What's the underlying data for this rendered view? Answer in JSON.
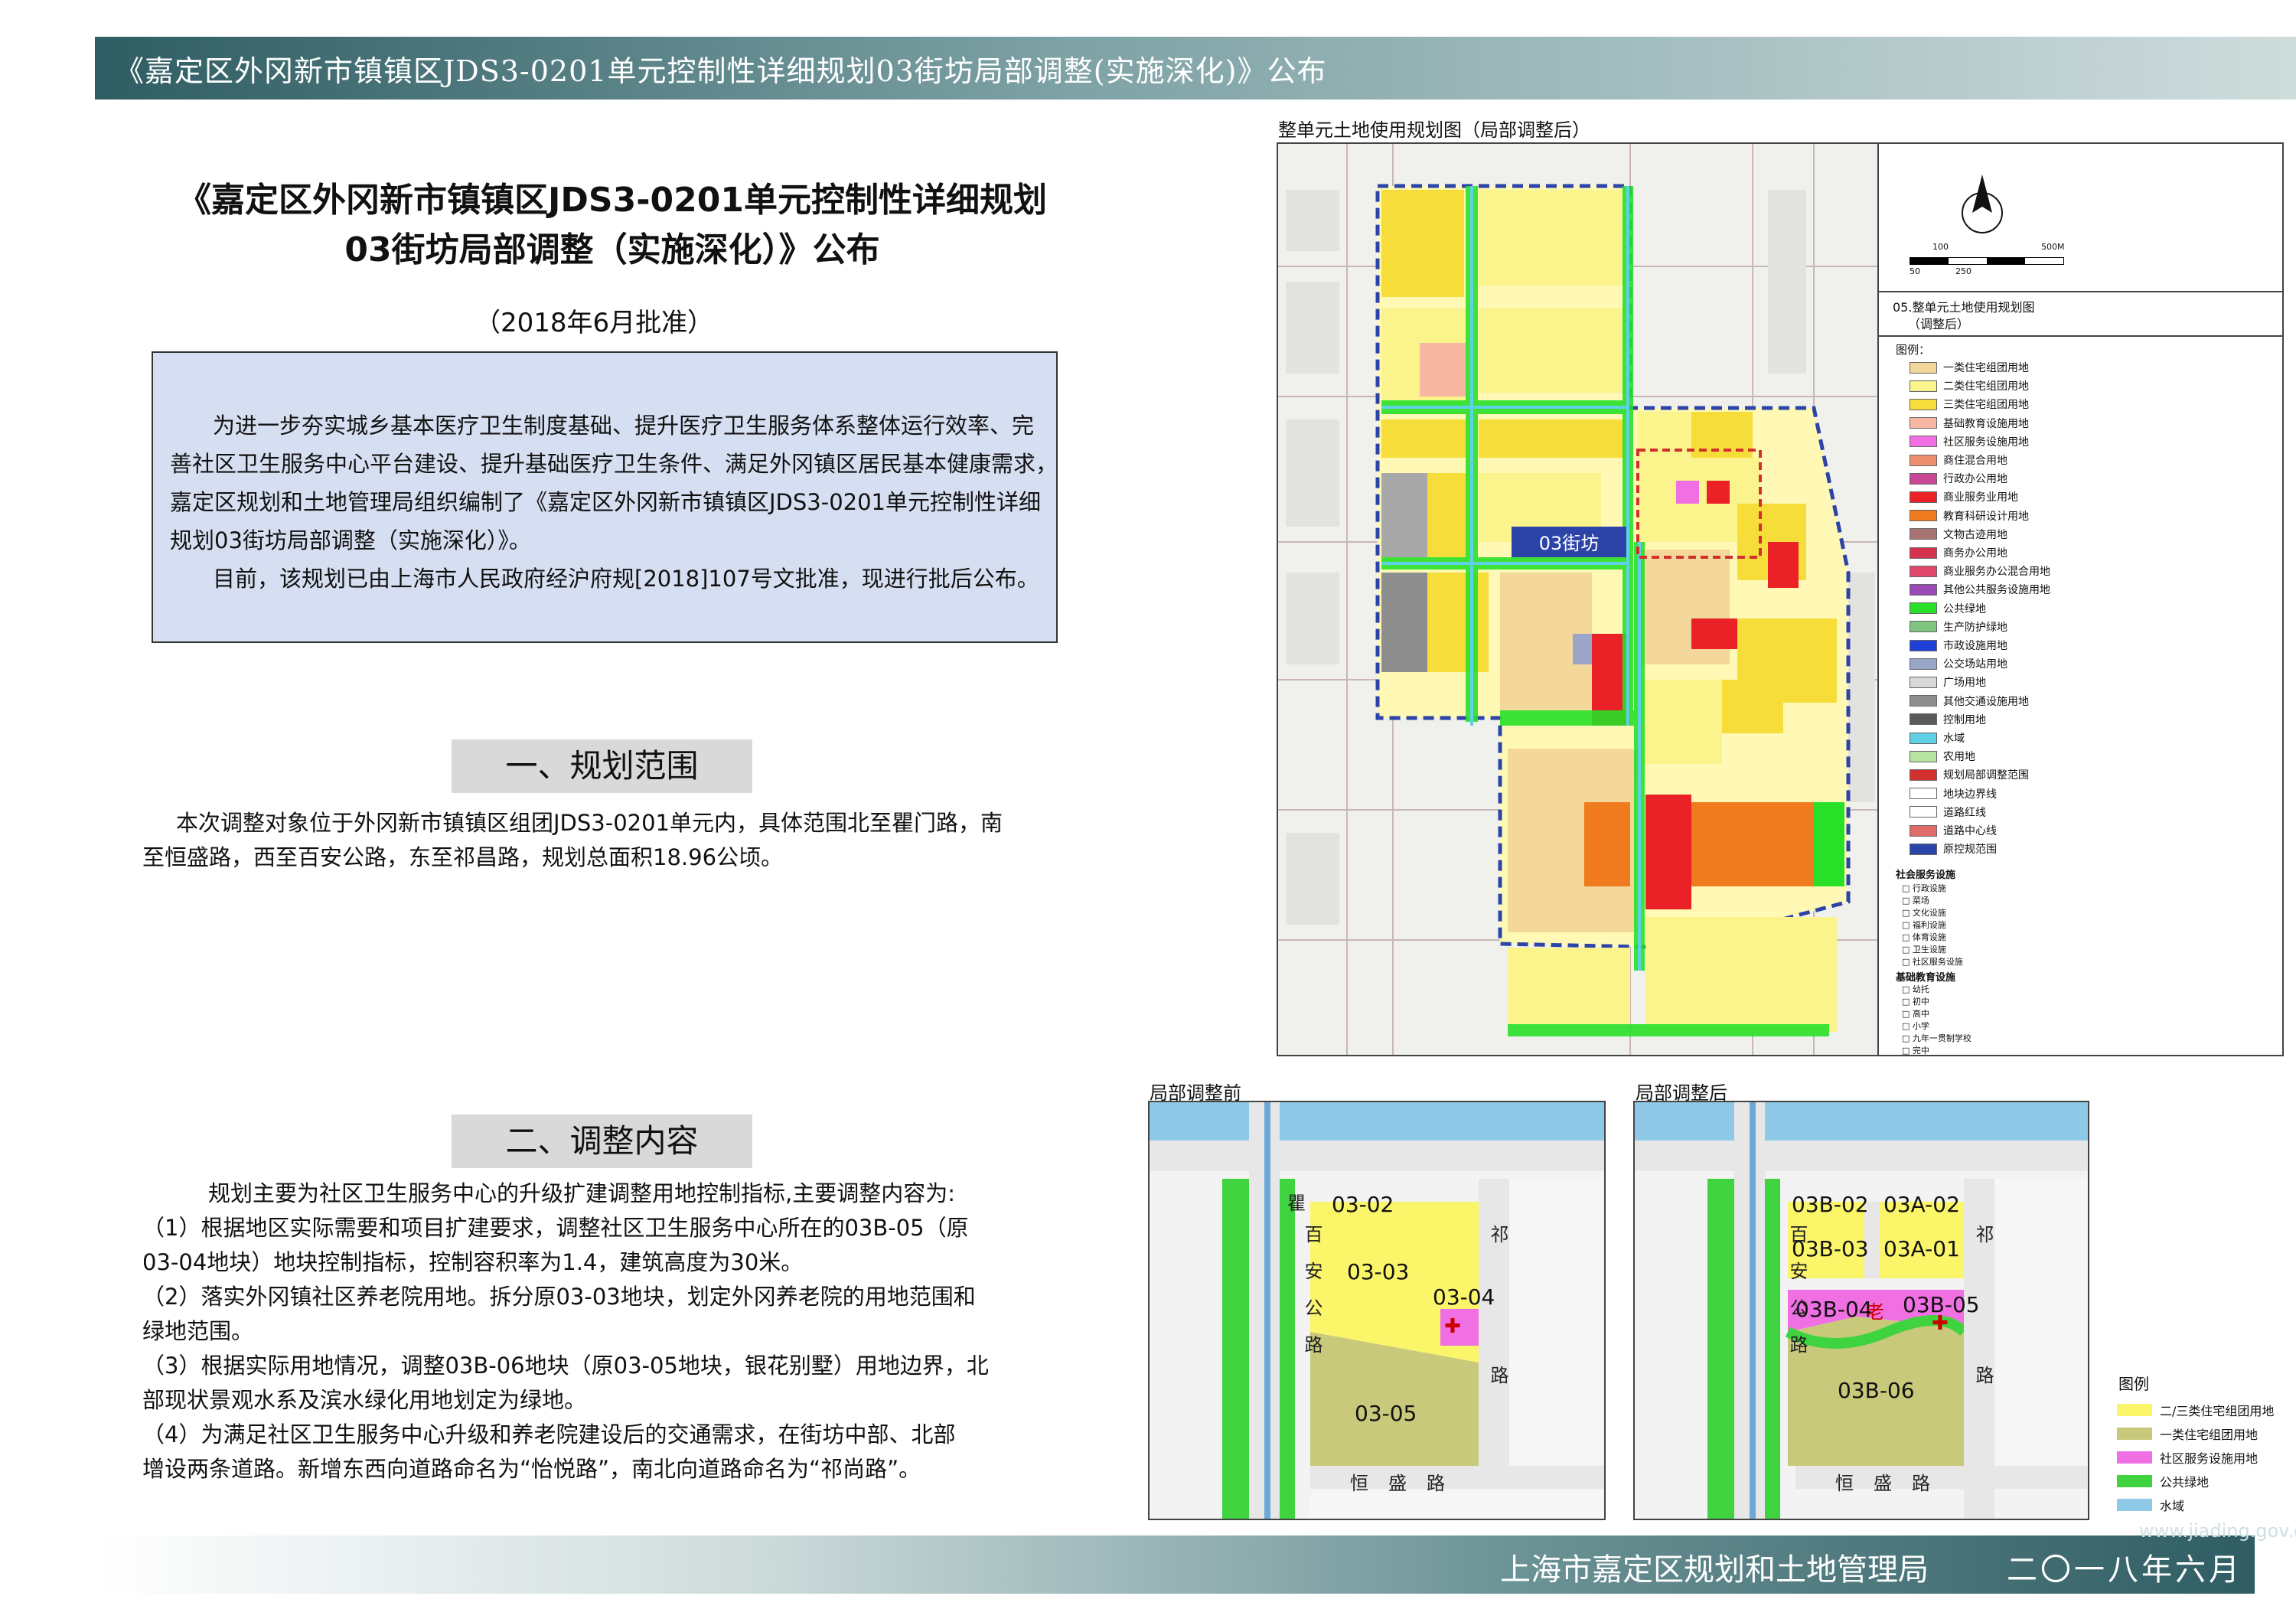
{
  "header": {
    "title": "《嘉定区外冈新市镇镇区JDS3-0201单元控制性详细规划03街坊局部调整(实施深化)》公布"
  },
  "doc": {
    "title_line1": "《嘉定区外冈新市镇镇区JDS3-0201单元控制性详细规划",
    "title_line2": "03街坊局部调整（实施深化）》公布",
    "approval": "（2018年6月批准）",
    "intro_lines": [
      "为进一步夯实城乡基本医疗卫生制度基础、提升医疗卫生服务体系整体运行效率、完",
      "善社区卫生服务中心平台建设、提升基础医疗卫生条件、满足外冈镇区居民基本健康需求，",
      "嘉定区规划和土地管理局组织编制了《嘉定区外冈新市镇镇区JDS3-0201单元控制性详细",
      "规划03街坊局部调整（实施深化）》。",
      "目前，该规划已由上海市人民政府经沪府规[2018]107号文批准，现进行批后公布。"
    ],
    "section1": {
      "heading": "一、规划范围",
      "lines": [
        "本次调整对象位于外冈新市镇镇区组团JDS3-0201单元内，具体范围北至瞿门路，南",
        "至恒盛路，西至百安公路，东至祁昌路，规划总面积18.96公顷。"
      ]
    },
    "section2": {
      "heading": "二、调整内容",
      "lines": [
        "规划主要为社区卫生服务中心的升级扩建调整用地控制指标,主要调整内容为:",
        "（1）根据地区实际需要和项目扩建要求，调整社区卫生服务中心所在的03B-05（原",
        "03-04地块）地块控制指标，控制容积率为1.4，建筑高度为30米。",
        "（2）落实外冈镇社区养老院用地。拆分原03-03地块，划定外冈养老院的用地范围和",
        "绿地范围。",
        "（3）根据实际用地情况，调整03B-06地块（原03-05地块，银花别墅）用地边界，北",
        "部现状景观水系及滨水绿化用地划定为绿地。",
        "（4）为满足社区卫生服务中心升级和养老院建设后的交通需求，在街坊中部、北部",
        "增设两条道路。新增东西向道路命名为“怡悦路”，南北向道路命名为“祁尚路”。"
      ]
    }
  },
  "main_map": {
    "title": "整单元土地使用规划图（局部调整后）",
    "block_label": "03街坊",
    "scale_top": [
      "100",
      "500M"
    ],
    "scale_bottom": [
      "50",
      "250"
    ],
    "panel_title_1": "05.整单元土地使用规划图",
    "panel_title_2": "（调整后）",
    "legend_heading": "图例：",
    "legend": [
      {
        "label": "一类住宅组团用地",
        "color": "#f4d79a"
      },
      {
        "label": "二类住宅组团用地",
        "color": "#fbf38c"
      },
      {
        "label": "三类住宅组团用地",
        "color": "#f7dd3a"
      },
      {
        "label": "基础教育设施用地",
        "color": "#f7b7a2"
      },
      {
        "label": "社区服务设施用地",
        "color": "#f06fe3"
      },
      {
        "label": "商住混合用地",
        "color": "#ee8f70"
      },
      {
        "label": "行政办公用地",
        "color": "#c94795"
      },
      {
        "label": "商业服务业用地",
        "color": "#ea2126"
      },
      {
        "label": "教育科研设计用地",
        "color": "#ef7b1e"
      },
      {
        "label": "文物古迹用地",
        "color": "#a77373"
      },
      {
        "label": "商务办公用地",
        "color": "#d3334c"
      },
      {
        "label": "商业服务办公混合用地",
        "color": "#e0476b"
      },
      {
        "label": "其他公共服务设施用地",
        "color": "#9a4bb5"
      },
      {
        "label": "公共绿地",
        "color": "#28e028"
      },
      {
        "label": "生产防护绿地",
        "color": "#7fc47f"
      },
      {
        "label": "市政设施用地",
        "color": "#1f3fd6"
      },
      {
        "label": "公交场站用地",
        "color": "#9aa6c7"
      },
      {
        "label": "广场用地",
        "color": "#d9d9d9"
      },
      {
        "label": "其他交通设施用地",
        "color": "#8d8d8d"
      },
      {
        "label": "控制用地",
        "color": "#5a5a5a"
      },
      {
        "label": "水域",
        "color": "#5fd0e6"
      },
      {
        "label": "农用地",
        "color": "#b7e3a0"
      },
      {
        "label": "规划局部调整范围",
        "color": "#d32f2f"
      },
      {
        "label": "地块边界线",
        "color": "#ffffff"
      },
      {
        "label": "道路红线",
        "color": "#ffffff"
      },
      {
        "label": "道路中心线",
        "color": "#e06b6b"
      },
      {
        "label": "原控规范围",
        "color": "#2c44a8"
      }
    ],
    "facility_heading": "社会服务设施",
    "facilities": [
      "行政设施",
      "菜场",
      "文化设施",
      "福利设施",
      "体育设施",
      "卫生设施",
      "社区服务设施"
    ],
    "edu_heading": "基础教育设施",
    "edu": [
      "幼托",
      "初中",
      "高中",
      "小学",
      "九年一贯制学校",
      "完中"
    ]
  },
  "detail_before": {
    "title": "局部调整前",
    "parcels": [
      "03-02",
      "03-03",
      "03-04",
      "03-05"
    ],
    "road_west": "百安公路",
    "road_south": "恒盛路",
    "road_north": "瞿",
    "road_east": "祁路"
  },
  "detail_after": {
    "title": "局部调整后",
    "parcels": [
      "03B-02",
      "03A-02",
      "03B-03",
      "03A-01",
      "03B-04",
      "03B-05",
      "03B-06"
    ],
    "elder_mark": "老",
    "road_west": "百安公路",
    "road_south": "恒盛路",
    "road_east": "祁路"
  },
  "detail_legend": {
    "heading": "图例",
    "items": [
      {
        "label": "二/三类住宅组团用地",
        "color": "#fbf56a"
      },
      {
        "label": "一类住宅组团用地",
        "color": "#c9c97b"
      },
      {
        "label": "社区服务设施用地",
        "color": "#f06fe3"
      },
      {
        "label": "公共绿地",
        "color": "#3fd43f"
      },
      {
        "label": "水域",
        "color": "#8fc9e8"
      }
    ]
  },
  "footer": {
    "org": "上海市嘉定区规划和土地管理局",
    "date": "二〇一八年六月",
    "watermark": "www.jiading.gov.cn"
  }
}
